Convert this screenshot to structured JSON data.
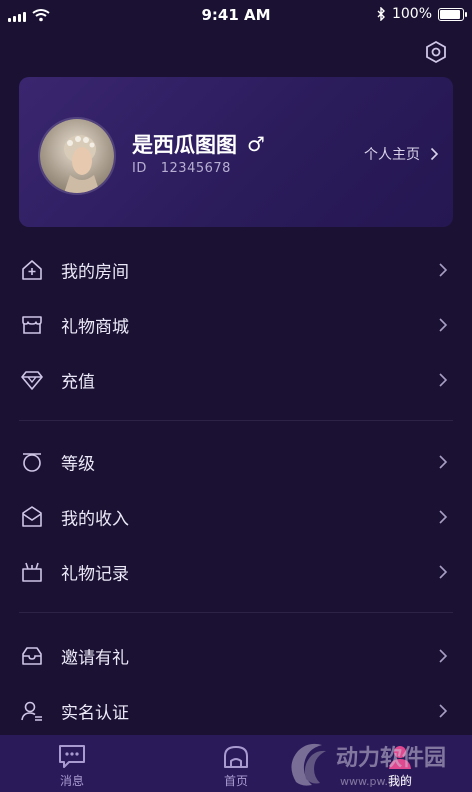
{
  "status_bar": {
    "time": "9:41 AM",
    "battery": "100%"
  },
  "profile": {
    "name": "是西瓜图图",
    "gender_symbol": "♂",
    "id_label": "ID",
    "id_value": "12345678",
    "homepage_link": "个人主页"
  },
  "menu_group_1": [
    {
      "label": "我的房间",
      "icon": "house-plus-icon"
    },
    {
      "label": "礼物商城",
      "icon": "store-icon"
    },
    {
      "label": "充值",
      "icon": "diamond-icon"
    }
  ],
  "menu_group_2": [
    {
      "label": "等级",
      "icon": "level-icon"
    },
    {
      "label": "我的收入",
      "icon": "income-envelope-icon"
    },
    {
      "label": "礼物记录",
      "icon": "gift-basket-icon"
    }
  ],
  "menu_group_3": [
    {
      "label": "邀请有礼",
      "icon": "invite-inbox-icon"
    },
    {
      "label": "实名认证",
      "icon": "user-verify-icon"
    }
  ],
  "tabbar": {
    "tabs": [
      {
        "label": "消息",
        "icon": "message-icon"
      },
      {
        "label": "首页",
        "icon": "home-icon"
      },
      {
        "label": "我的",
        "icon": "profile-icon"
      }
    ],
    "active_index": 2
  },
  "watermark": {
    "text": "动力软件园",
    "subtext": "www.pw.com"
  },
  "colors": {
    "background": "#1a1133",
    "card": "#2f1f63",
    "tabbar": "#2b1a5a",
    "accent": "#e0488f"
  }
}
